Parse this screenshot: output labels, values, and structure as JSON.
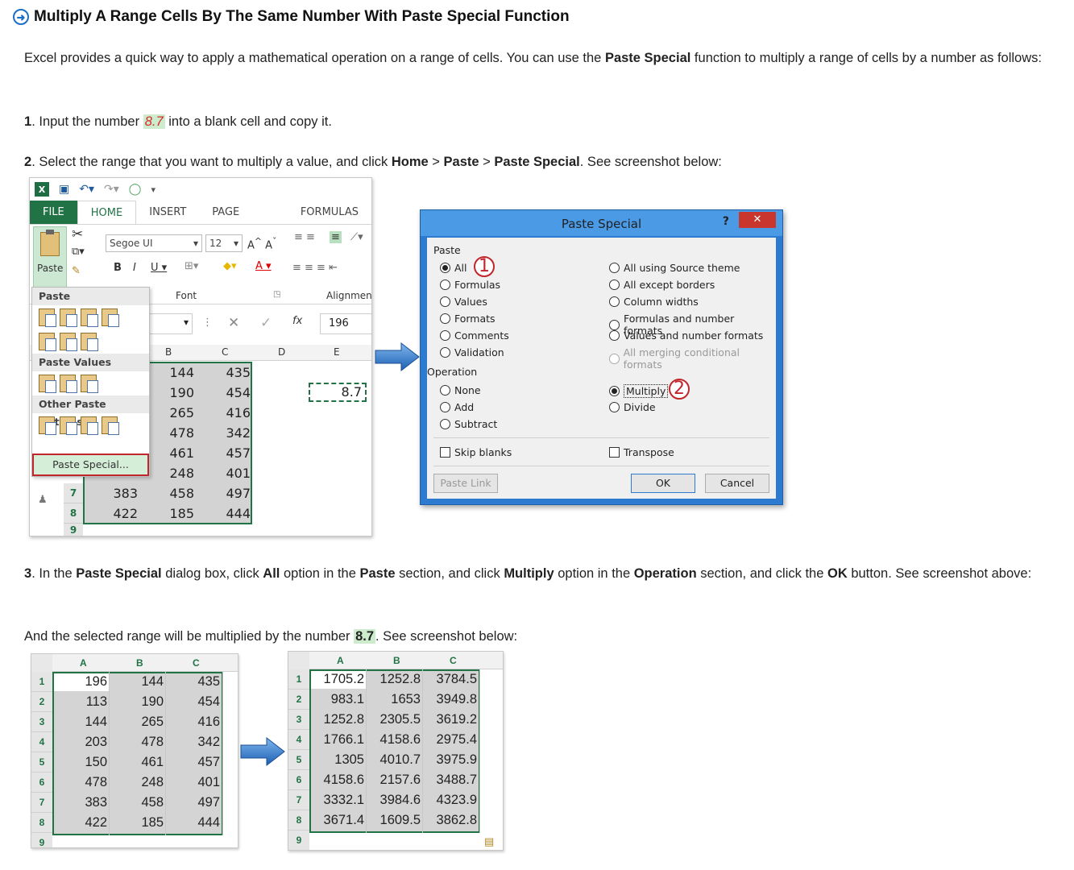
{
  "heading": "Multiply A Range Cells By The Same Number With Paste Special Function",
  "intro": {
    "part1": "Excel provides a quick way to apply a mathematical operation on a range of cells. You can use the ",
    "bold": "Paste Special",
    "part2": " function to multiply a range of cells by a number as follows:"
  },
  "step1": {
    "num": "1",
    "pre": ". Input the number ",
    "value": "8.7",
    "post": " into a blank cell and copy it."
  },
  "step2": {
    "num": "2",
    "pre": ". Select the range that you want to multiply a value, and click ",
    "b1": "Home",
    "sep1": " > ",
    "b2": "Paste",
    "sep2": " > ",
    "b3": "Paste Special",
    "post": ". See screenshot below:"
  },
  "step3": {
    "num": "3",
    "p1": ". In the ",
    "b1": "Paste Special",
    "p2": " dialog box, click ",
    "b2": "All",
    "p3": " option in the ",
    "b3": "Paste",
    "p4": " section, and click ",
    "b4": "Multiply",
    "p5": " option in the ",
    "b5": "Operation",
    "p6": " section, and click the ",
    "b6": "OK",
    "p7": " button. See screenshot above:"
  },
  "result_line": {
    "pre": "And the selected range will be multiplied by the number ",
    "value": "8.7",
    "post": ". See screenshot below:"
  },
  "excel": {
    "tabs": [
      "FILE",
      "HOME",
      "INSERT",
      "PAGE LAYOUT",
      "FORMULAS"
    ],
    "paste_label": "Paste",
    "font_name": "Segoe UI",
    "font_size": "12",
    "group_font": "Font",
    "group_alignment": "Alignment",
    "fx": "fx",
    "formula_value": "196",
    "col_headers": [
      "B",
      "C",
      "D",
      "E"
    ],
    "menu": {
      "paste": "Paste",
      "paste_values": "Paste Values",
      "other": "Other Paste Options",
      "paste_special": "Paste Special..."
    },
    "rows": [
      {
        "b": "144",
        "c": "435"
      },
      {
        "b": "190",
        "c": "454"
      },
      {
        "b": "265",
        "c": "416"
      },
      {
        "b": "478",
        "c": "342"
      },
      {
        "b": "461",
        "c": "457"
      },
      {
        "b": "248",
        "c": "401"
      },
      {
        "n": "7",
        "a": "383",
        "b": "458",
        "c": "497"
      },
      {
        "n": "8",
        "a": "422",
        "b": "185",
        "c": "444"
      }
    ],
    "row9": "9",
    "copy_cell": "8.7"
  },
  "dialog": {
    "title": "Paste Special",
    "help": "?",
    "close": "✕",
    "paste_group": "Paste",
    "paste_left": [
      "All",
      "Formulas",
      "Values",
      "Formats",
      "Comments",
      "Validation"
    ],
    "paste_right": [
      "All using Source theme",
      "All except borders",
      "Column widths",
      "Formulas and number formats",
      "Values and number formats",
      "All merging conditional formats"
    ],
    "operation_group": "Operation",
    "op_left": [
      "None",
      "Add",
      "Subtract"
    ],
    "op_right": [
      "Multiply",
      "Divide"
    ],
    "skip_blanks": "Skip blanks",
    "transpose": "Transpose",
    "paste_link": "Paste Link",
    "ok": "OK",
    "cancel": "Cancel",
    "marker1": "1",
    "marker2": "2"
  },
  "before": {
    "cols": [
      "A",
      "B",
      "C"
    ],
    "rows": [
      [
        "196",
        "144",
        "435"
      ],
      [
        "113",
        "190",
        "454"
      ],
      [
        "144",
        "265",
        "416"
      ],
      [
        "203",
        "478",
        "342"
      ],
      [
        "150",
        "461",
        "457"
      ],
      [
        "478",
        "248",
        "401"
      ],
      [
        "383",
        "458",
        "497"
      ],
      [
        "422",
        "185",
        "444"
      ]
    ],
    "row_nums": [
      "1",
      "2",
      "3",
      "4",
      "5",
      "6",
      "7",
      "8",
      "9"
    ]
  },
  "after": {
    "cols": [
      "A",
      "B",
      "C"
    ],
    "rows": [
      [
        "1705.2",
        "1252.8",
        "3784.5"
      ],
      [
        "983.1",
        "1653",
        "3949.8"
      ],
      [
        "1252.8",
        "2305.5",
        "3619.2"
      ],
      [
        "1766.1",
        "4158.6",
        "2975.4"
      ],
      [
        "1305",
        "4010.7",
        "3975.9"
      ],
      [
        "4158.6",
        "2157.6",
        "3488.7"
      ],
      [
        "3332.1",
        "3984.6",
        "4323.9"
      ],
      [
        "3671.4",
        "1609.5",
        "3862.8"
      ]
    ],
    "row_nums": [
      "1",
      "2",
      "3",
      "4",
      "5",
      "6",
      "7",
      "8",
      "9"
    ]
  },
  "colors": {
    "accent": "#1c6fc7",
    "excel_green": "#217346",
    "highlight": "#cdeccd",
    "marker_red": "#c0262c"
  }
}
